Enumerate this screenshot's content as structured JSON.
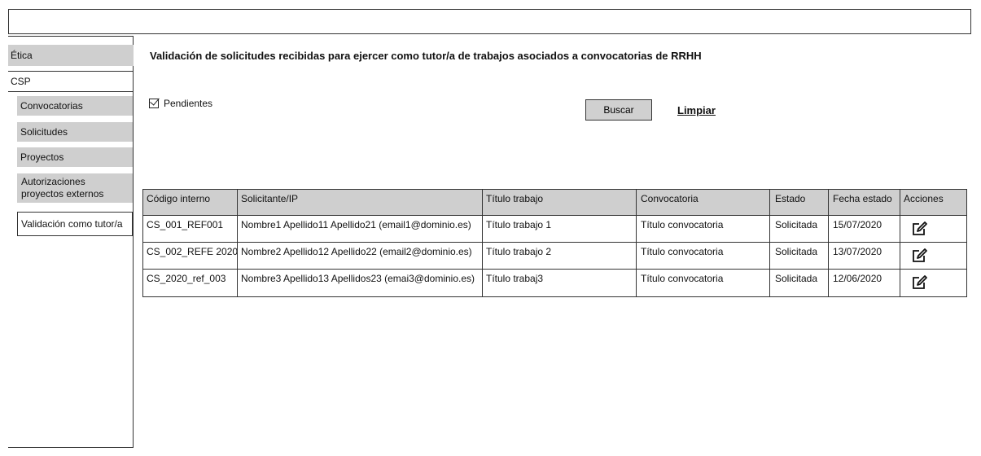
{
  "sidebar": {
    "items": [
      {
        "label": "Ética"
      },
      {
        "label": "CSP"
      },
      {
        "label": "Convocatorias"
      },
      {
        "label": "Solicitudes"
      },
      {
        "label": "Proyectos"
      },
      {
        "label": "Autorizaciones proyectos externos"
      },
      {
        "label": "Validación como tutor/a"
      }
    ]
  },
  "main": {
    "title": "Validación de solicitudes recibidas para ejercer como tutor/a de trabajos asociados a convocatorias de RRHH",
    "filter_checkbox_label": "Pendientes",
    "search_button": "Buscar",
    "clear_link": "Limpiar"
  },
  "table": {
    "headers": [
      "Código interno",
      "Solicitante/IP",
      "Título trabajo",
      "Convocatoria",
      "Estado",
      "Fecha estado",
      "Acciones"
    ],
    "rows": [
      {
        "codigo": "CS_001_REF001",
        "solicitante": "Nombre1 Apellido11 Apellido21 (email1@dominio.es)",
        "titulo": "Título trabajo 1",
        "convocatoria": "Título convocatoria",
        "estado": "Solicitada",
        "fecha": "15/07/2020"
      },
      {
        "codigo": "CS_002_REFE 2020",
        "solicitante": "Nombre2 Apellido12 Apellido22 (email2@dominio.es)",
        "titulo": "Título trabajo 2",
        "convocatoria": "Título convocatoria",
        "estado": "Solicitada",
        "fecha": "13/07/2020"
      },
      {
        "codigo": "CS_2020_ref_003",
        "solicitante": "Nombre3 Apellido13 Apellidos23 (emai3@dominio.es)",
        "titulo": "Título trabaj3",
        "convocatoria": "Título convocatoria",
        "estado": "Solicitada",
        "fecha": "12/06/2020"
      }
    ],
    "action_icon": "edit-icon"
  }
}
